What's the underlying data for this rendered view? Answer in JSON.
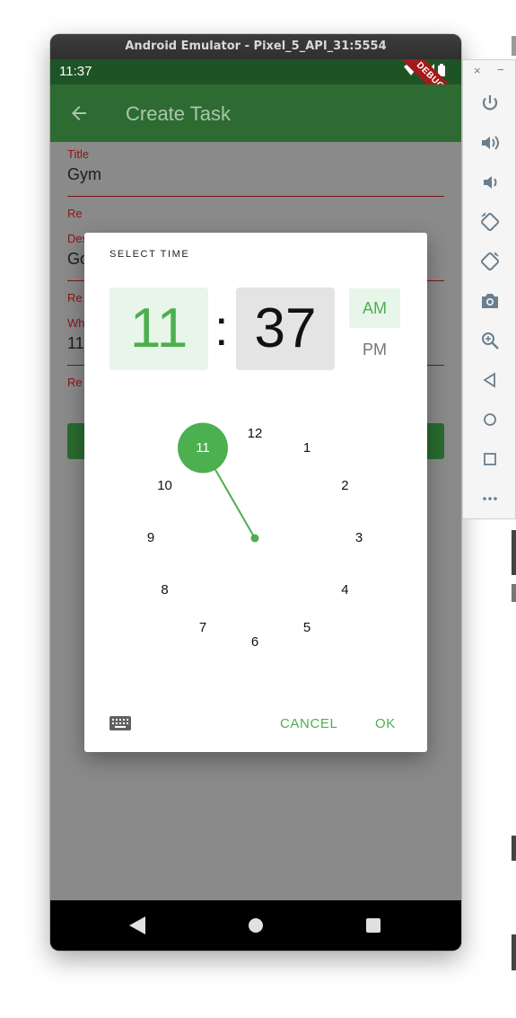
{
  "window": {
    "title": "Android Emulator - Pixel_5_API_31:5554"
  },
  "status_bar": {
    "time": "11:37",
    "debug_label": "DEBUG"
  },
  "app_bar": {
    "title": "Create Task"
  },
  "form": {
    "title_label": "Title",
    "title_value": "Gym",
    "field2_label": "Re",
    "desc_label": "Des",
    "desc_value": "Go",
    "field4_label": "Re",
    "when_label": "Wh",
    "when_value": "11",
    "field6_label": "Re"
  },
  "time_picker": {
    "header": "SELECT TIME",
    "hour": "11",
    "separator": ":",
    "minute": "37",
    "am_label": "AM",
    "pm_label": "PM",
    "period_selected": "AM",
    "selected_hour": 11,
    "dial_numbers": [
      "12",
      "1",
      "2",
      "3",
      "4",
      "5",
      "6",
      "7",
      "8",
      "9",
      "10",
      "11"
    ],
    "cancel_label": "CANCEL",
    "ok_label": "OK",
    "accent_color": "#4caf50",
    "accent_light": "#e8f5e9"
  },
  "colors": {
    "app_bar": "#2e6b32",
    "status_bar": "#1e5425",
    "error_label": "#8a1616"
  },
  "side_toolbar": {
    "close_label": "×",
    "minimize_label": "−",
    "icons": [
      "power-icon",
      "volume-up-icon",
      "volume-down-icon",
      "rotate-left-icon",
      "rotate-right-icon",
      "camera-icon",
      "zoom-icon",
      "back-icon",
      "home-icon",
      "overview-icon",
      "more-icon"
    ]
  }
}
